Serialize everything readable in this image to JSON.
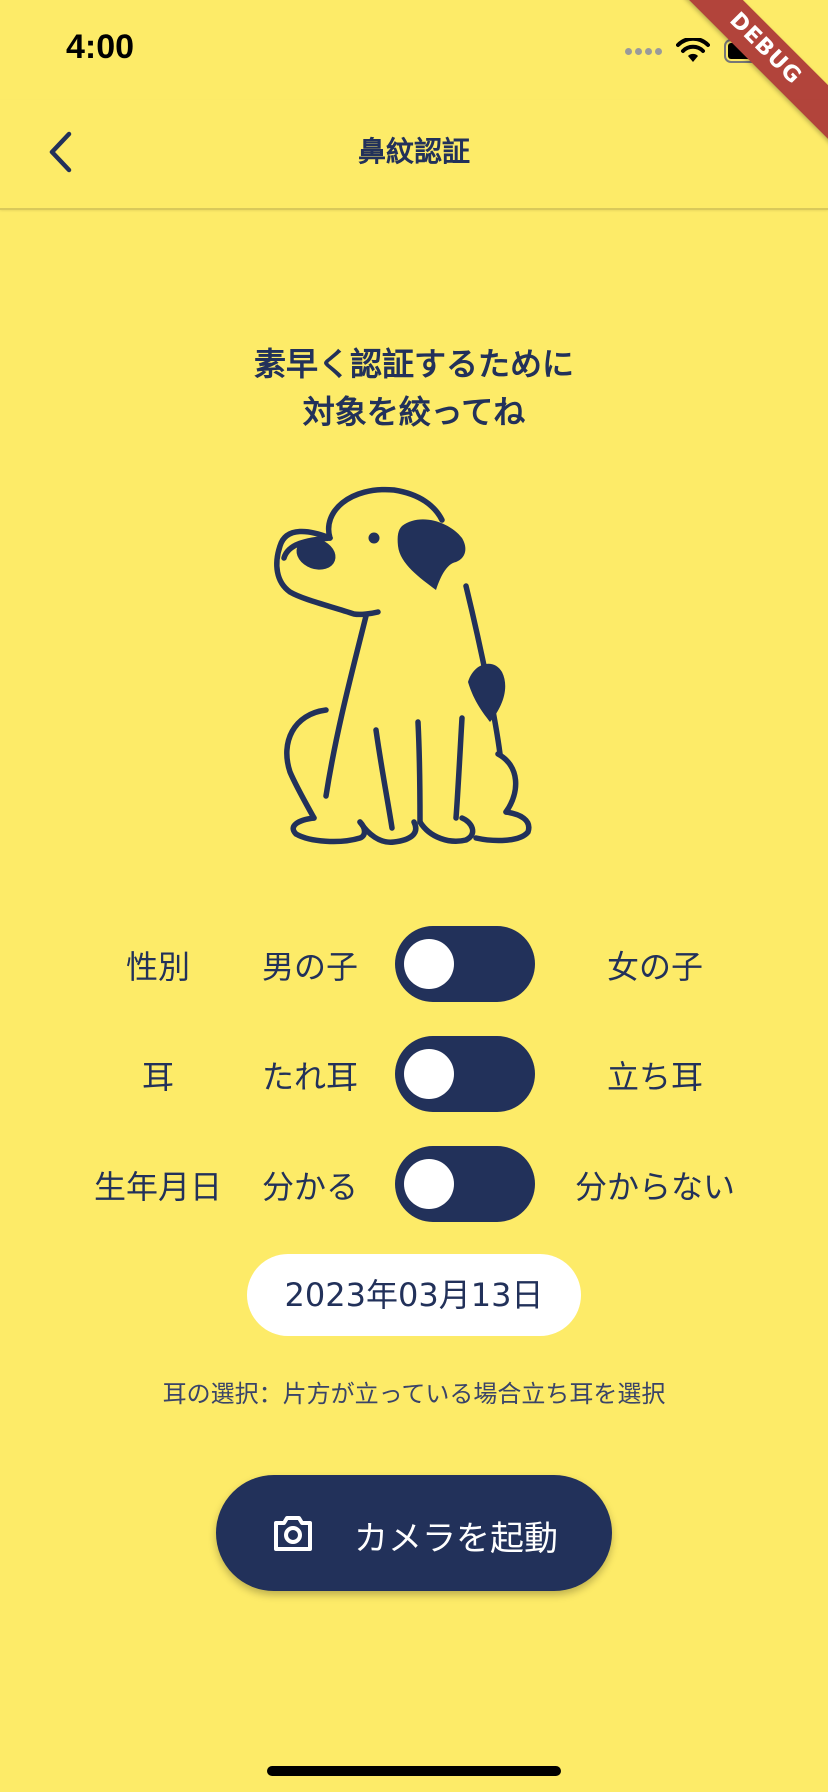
{
  "status_bar": {
    "time": "4:00",
    "debug_label": "DEBUG"
  },
  "app_bar": {
    "title": "鼻紋認証"
  },
  "headline": {
    "line1": "素早く認証するために",
    "line2": "対象を絞ってね"
  },
  "filters": [
    {
      "label": "性別",
      "left_option": "男の子",
      "right_option": "女の子",
      "selected": "left"
    },
    {
      "label": "耳",
      "left_option": "たれ耳",
      "right_option": "立ち耳",
      "selected": "left"
    },
    {
      "label": "生年月日",
      "left_option": "分かる",
      "right_option": "分からない",
      "selected": "left"
    }
  ],
  "birthdate": {
    "value": "2023年03月13日"
  },
  "note": "耳の選択：片方が立っている場合立ち耳を選択",
  "camera_button": {
    "label": "カメラを起動",
    "icon": "camera-icon"
  },
  "colors": {
    "background": "#fdeb68",
    "primary": "#22315a",
    "debug_ribbon": "#b2443b"
  }
}
